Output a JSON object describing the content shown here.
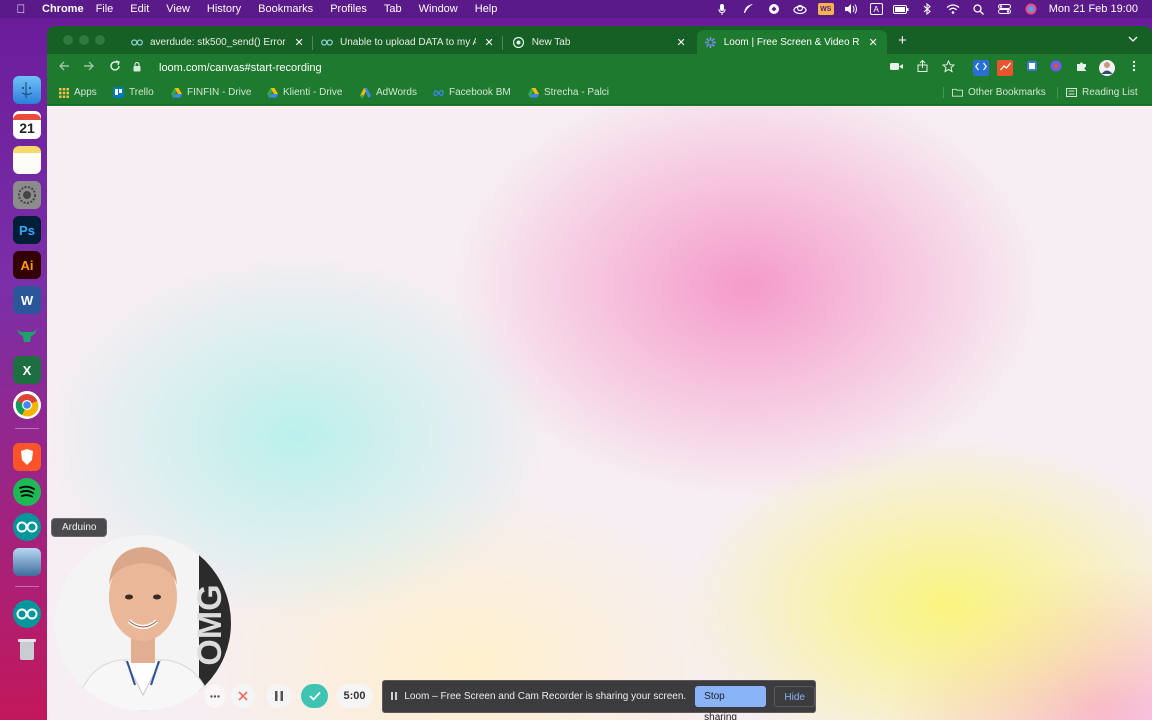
{
  "menubar": {
    "app_name": "Chrome",
    "menus": [
      "File",
      "Edit",
      "View",
      "History",
      "Bookmarks",
      "Profiles",
      "Tab",
      "Window",
      "Help"
    ],
    "clock": "Mon 21 Feb  19:00",
    "ws_badge": "WS",
    "input_source": "A"
  },
  "dock": {
    "calendar_day": "21",
    "photoshop_label": "Ps",
    "illustrator_label": "Ai",
    "word_label": "W",
    "excel_label": "X",
    "tooltip": "Arduino"
  },
  "browser": {
    "tabs": [
      {
        "title": "averdude: stk500_send() Error",
        "favicon": "arduino-icon",
        "active": false
      },
      {
        "title": "Unable to upload DATA to my A",
        "favicon": "arduino-icon",
        "active": false
      },
      {
        "title": "New Tab",
        "favicon": "chrome-icon",
        "active": false
      },
      {
        "title": "Loom | Free Screen & Video Re",
        "favicon": "loom-icon",
        "active": true
      }
    ],
    "url": "loom.com/canvas#start-recording",
    "bookmarks": [
      {
        "label": "Apps",
        "icon": "apps-grid-icon"
      },
      {
        "label": "Trello",
        "icon": "trello-icon"
      },
      {
        "label": "FINFIN - Drive",
        "icon": "drive-icon"
      },
      {
        "label": "Klienti - Drive",
        "icon": "drive-icon"
      },
      {
        "label": "AdWords",
        "icon": "adwords-icon"
      },
      {
        "label": "Facebook BM",
        "icon": "meta-icon"
      },
      {
        "label": "Strecha - Palci",
        "icon": "drive-icon"
      }
    ],
    "other_bookmarks": "Other Bookmarks",
    "reading_list": "Reading List"
  },
  "loom": {
    "timer": "5:00",
    "cam_overlay_text": "OMG"
  },
  "sharebar": {
    "message": "Loom – Free Screen and Cam Recorder is sharing your screen.",
    "stop_label": "Stop sharing",
    "hide_label": "Hide"
  },
  "colors": {
    "chrome_frame": "#1e7a2e",
    "tab_strip": "#165f25",
    "stop_button": "#8ab4f8",
    "loom_check": "#3fc4b4",
    "loom_cancel": "#f26b6b"
  }
}
